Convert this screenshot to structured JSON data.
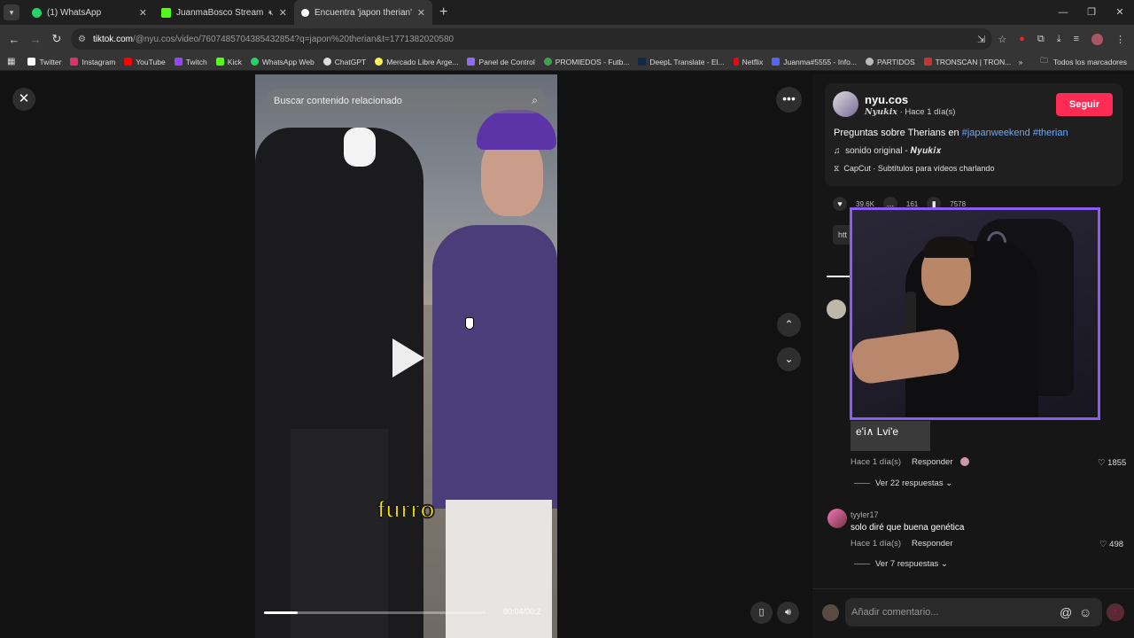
{
  "browser": {
    "tabs": [
      {
        "title": "(1) WhatsApp",
        "color": "#25d366",
        "active": false
      },
      {
        "title": "JuanmaBosco Stream - Wat",
        "color": "#53fc18",
        "active": false
      },
      {
        "title": "Encuentra 'japon therian' en Tik",
        "color": "#ffffff",
        "active": true
      }
    ],
    "tab_menu_icon": "chevron-down",
    "new_tab": "+",
    "url_host": "tiktok.com",
    "url_path": "/@nyu.cos/video/7607485704385432854?q=japon%20therian&t=1771382020580",
    "bookmarks": [
      {
        "label": "Twitter",
        "color": "#ffffff"
      },
      {
        "label": "Instagram",
        "color": "#e1306c"
      },
      {
        "label": "YouTube",
        "color": "#ff0000"
      },
      {
        "label": "Twitch",
        "color": "#9146ff"
      },
      {
        "label": "Kick",
        "color": "#53fc18"
      },
      {
        "label": "WhatsApp Web",
        "color": "#25d366"
      },
      {
        "label": "ChatGPT",
        "color": "#dddddd"
      },
      {
        "label": "Mercado Libre Arge...",
        "color": "#fff159"
      },
      {
        "label": "Panel de Control",
        "color": "#8e6cef"
      },
      {
        "label": "PROMIEDOS - Futb...",
        "color": "#3fa34d"
      },
      {
        "label": "DeepL Translate - El...",
        "color": "#0f2b46"
      },
      {
        "label": "Netflix",
        "color": "#e50914"
      },
      {
        "label": "Juanma#5555 - Info...",
        "color": "#5865f2"
      },
      {
        "label": "PARTIDOS",
        "color": "#bbbbbb"
      },
      {
        "label": "TRONSCAN | TRON...",
        "color": "#c23631"
      }
    ],
    "bookmarks_more": "»",
    "all_bookmarks": "Todos los marcadores"
  },
  "video": {
    "search_placeholder": "Buscar contenido relacionado",
    "caption": "furro",
    "time": "00:04/00:2",
    "progress": 0.15
  },
  "creator": {
    "username": "nyu.cos",
    "display_name": "𝑵𝒚𝒖𝒌𝒊𝒙",
    "posted": "· Hace 1 día(s)",
    "follow_label": "Seguir",
    "description": "Preguntas sobre Therians en ",
    "hashtags": [
      "#japanweekend",
      "#therian"
    ],
    "music": "sonido original - 𝑵𝒚𝒖𝒌𝒊𝒙",
    "capcut": "CapCut · Subtítulos para vídeos charlando",
    "likes": "39.6K",
    "comments": "161",
    "saves": "7578",
    "url_prefix": "htt"
  },
  "comments": [
    {
      "thumb_text": "e'i∧ Lvi'e",
      "meta": "Hace 1 día(s)",
      "reply": "Responder",
      "likes": "1855",
      "more": "Ver 22 respuestas"
    },
    {
      "user": "tyyler17",
      "text": "solo diré que buena genética",
      "meta": "Hace 1 día(s)",
      "reply": "Responder",
      "likes": "498",
      "more": "Ver 7 respuestas"
    }
  ],
  "comment_input": {
    "placeholder": "Añadir comentario..."
  },
  "colors": {
    "accent": "#fe2c55",
    "hashtag": "#6aa8ff",
    "pip_border": "#8b5cf6",
    "caption": "#ffe600"
  }
}
